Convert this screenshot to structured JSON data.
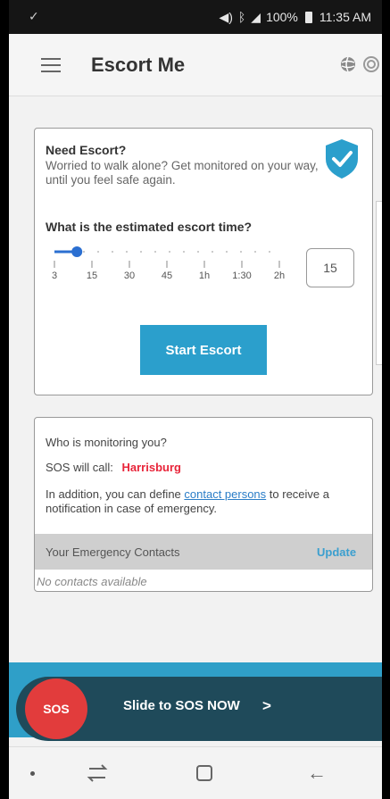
{
  "status_bar": {
    "left_glyph": "✓",
    "battery": "100%",
    "time": "11:35 AM"
  },
  "app_bar": {
    "title": "Escort Me"
  },
  "escort_card": {
    "title": "Need Escort?",
    "description": "Worried to walk alone? Get monitored on your way, until you feel safe again.",
    "time_label": "What is the estimated escort time?",
    "slider_ticks": [
      "3",
      "15",
      "30",
      "45",
      "1h",
      "1:30",
      "2h"
    ],
    "slider_value_fraction": 0.1,
    "time_value": "15",
    "start_button": "Start Escort"
  },
  "monitor_card": {
    "who": "Who is monitoring you?",
    "sos_call_prefix": "SOS will call:",
    "sos_call_name": "Harrisburg",
    "addition_before": "In addition, you can define ",
    "addition_link": "contact persons",
    "addition_after": " to receive a notification in case of emergency.",
    "contacts_header": "Your Emergency Contacts",
    "update_label": "Update",
    "no_contacts": "No contacts available"
  },
  "sos_slider": {
    "knob_label": "SOS",
    "label": "Slide to SOS NOW",
    "arrow": ">"
  },
  "colors": {
    "accent": "#2b9fcc",
    "sos_red": "#e23c3c",
    "link": "#2a7dc7",
    "name_red": "#e8253a"
  }
}
